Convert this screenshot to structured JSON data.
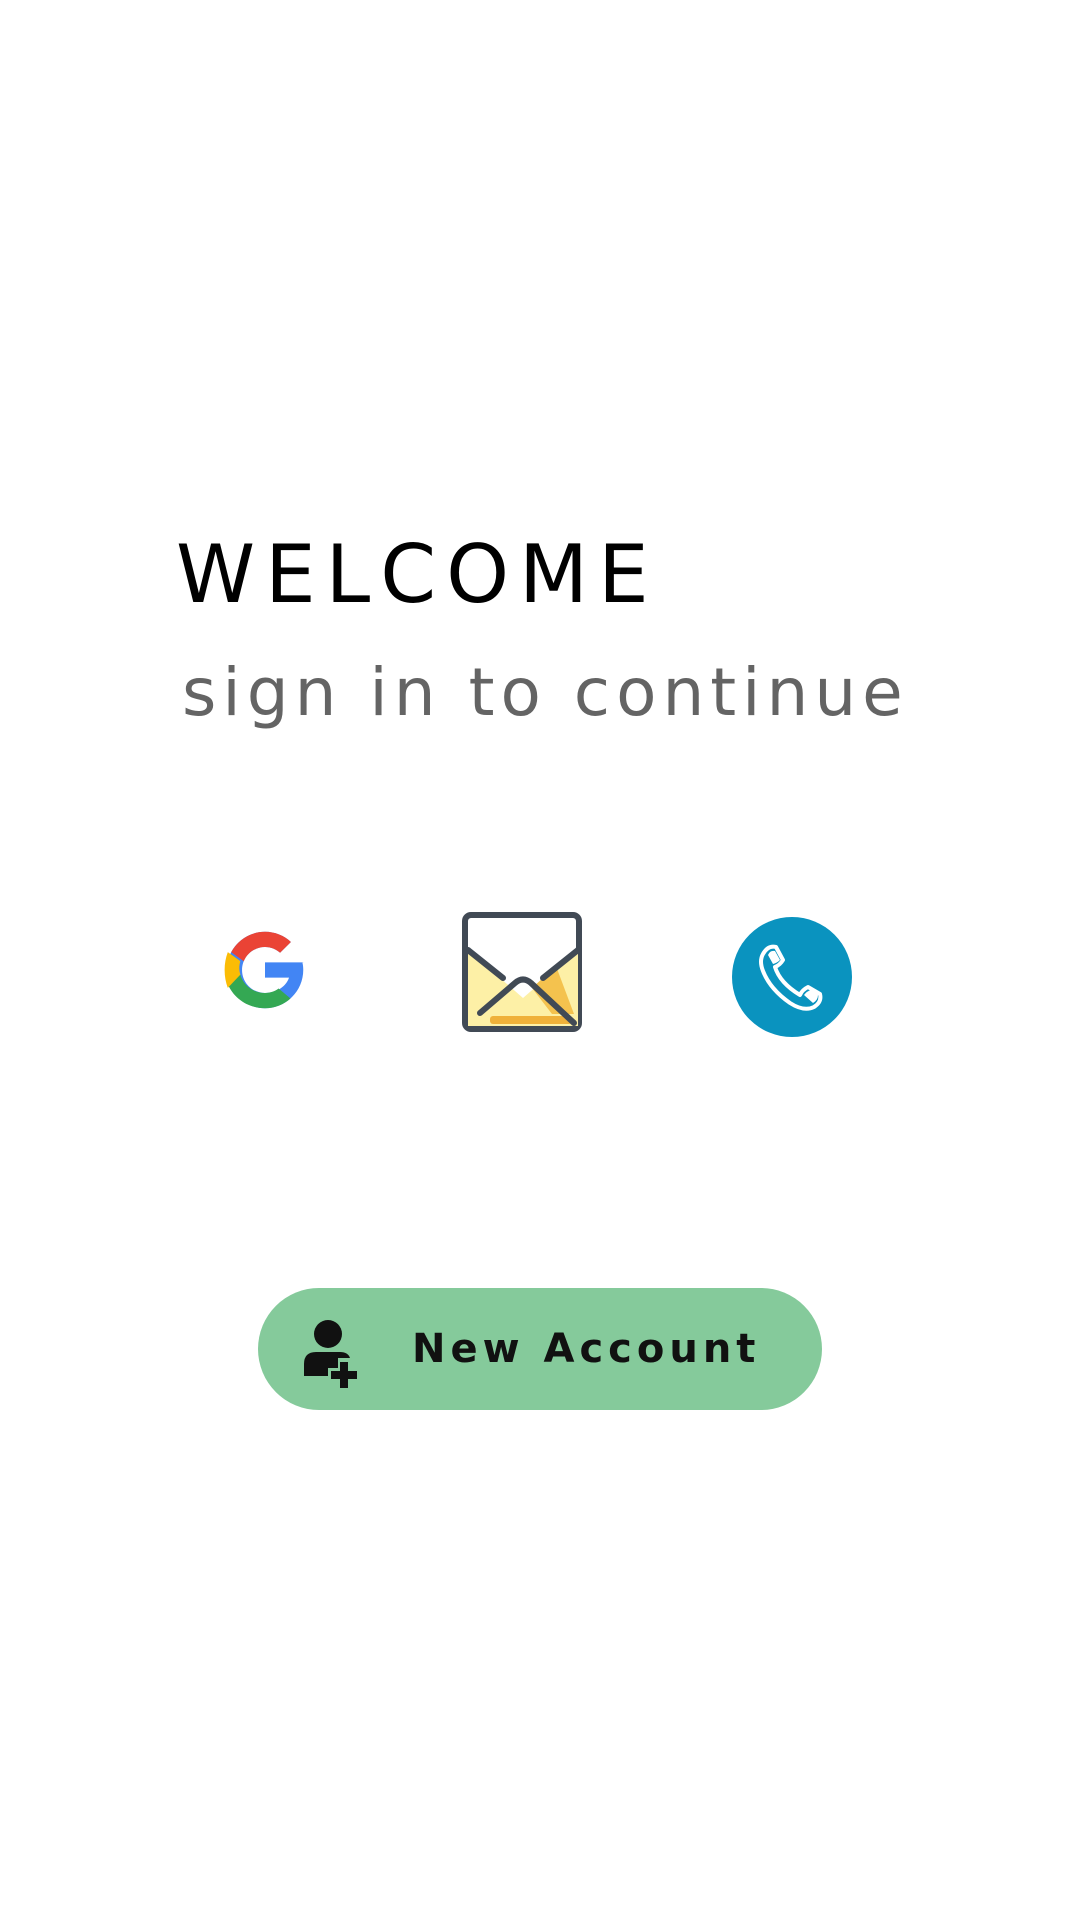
{
  "welcome": {
    "title": "WELCOME",
    "subtitle": "sign in to continue"
  },
  "sign_in_options": [
    {
      "icon": "google-icon"
    },
    {
      "icon": "envelope-icon"
    },
    {
      "icon": "phone-icon"
    }
  ],
  "new_account": {
    "label": "New Account",
    "icon": "add-user-icon",
    "background_color": "#85ca9b"
  },
  "colors": {
    "background": "#ffffff",
    "title": "#000000",
    "subtitle": "#646464",
    "phone_circle": "#0a93bf",
    "google_red": "#ea4335",
    "google_yellow": "#fbbc05",
    "google_green": "#34a853",
    "google_blue": "#4285f4"
  }
}
